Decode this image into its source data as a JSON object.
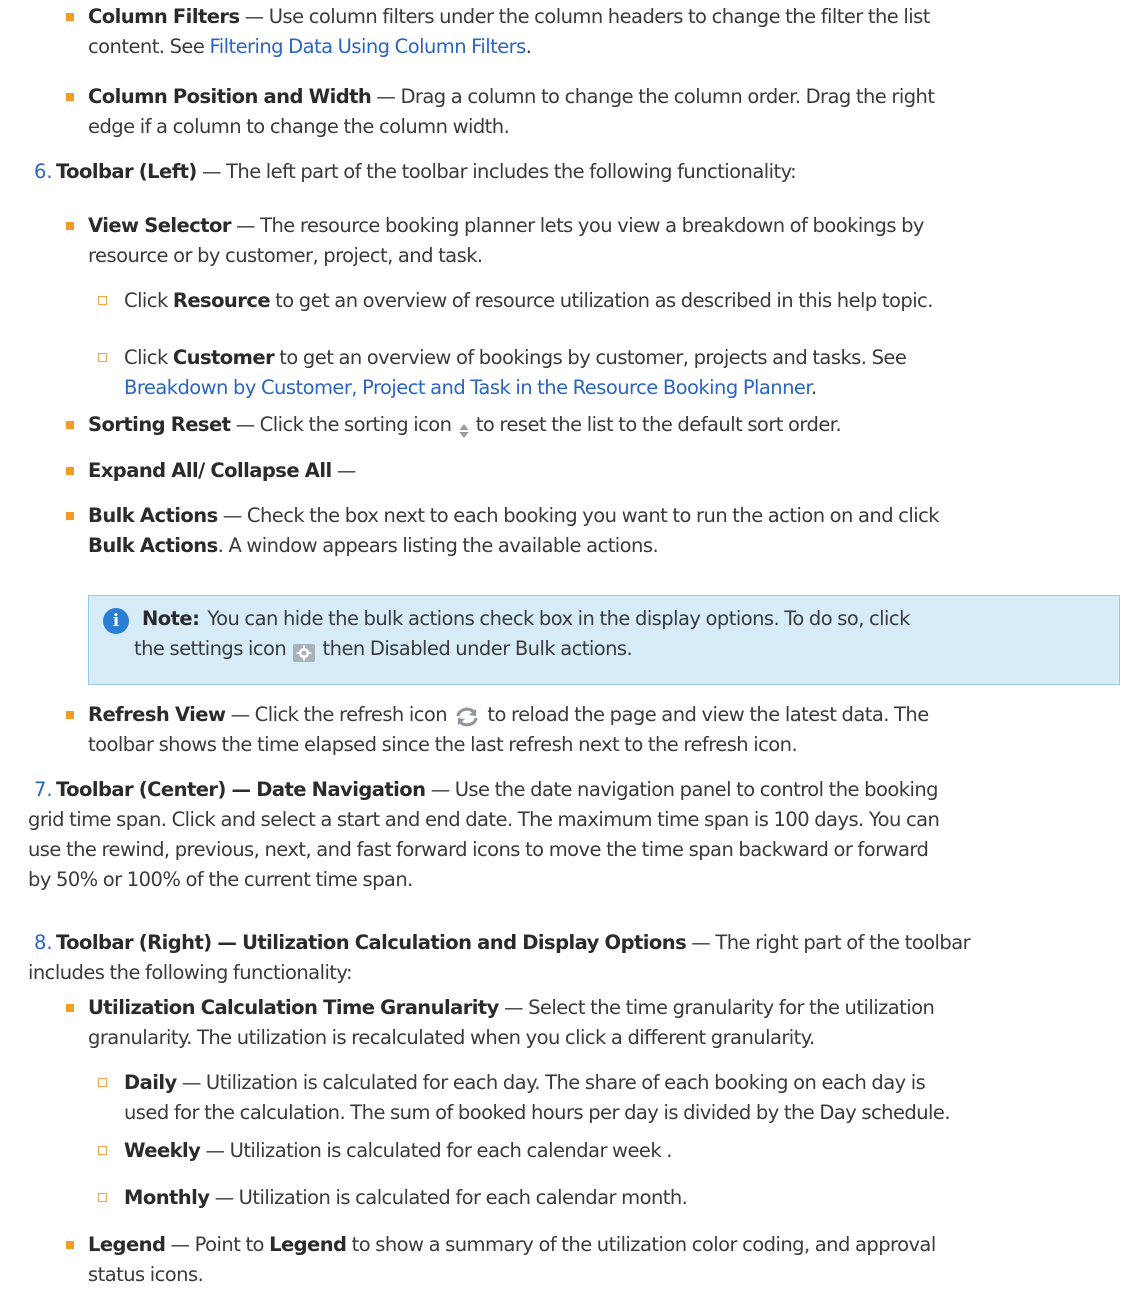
{
  "items": {
    "col_filters_title": "Column Filters",
    "col_filters_text_1": " — Use column filters under the column headers to change the filter the list",
    "col_filters_text_2": "content. See ",
    "col_filters_link": "Filtering Data Using Column Filters",
    "col_filters_end": ".",
    "col_pos_title": "Column Position and Width",
    "col_pos_text_1": " — Drag a column to change the column order. Drag the right",
    "col_pos_text_2": "edge if a column to change the column width.",
    "n6": "6.",
    "tb_left_title": "Toolbar (Left)",
    "tb_left_text": " — The left part of the toolbar includes the following functionality:",
    "view_sel_title": "View Selector",
    "view_sel_text_1": " — The resource booking planner lets you view a breakdown of bookings by",
    "view_sel_text_2": "resource or by customer, project, and task.",
    "resource_pre": "Click ",
    "resource_bold": "Resource",
    "resource_text": " to get an overview of resource utilization as described in this help topic.",
    "customer_pre": "Click ",
    "customer_bold": "Customer",
    "customer_text": " to get an overview of bookings by customer, projects and tasks. See",
    "customer_link": "Breakdown by Customer, Project and Task in the Resource Booking Planner",
    "customer_end": ".",
    "sort_title": "Sorting Reset",
    "sort_text_1": " — Click the sorting icon ",
    "sort_text_2": " to reset the list to the default sort order.",
    "expand_title": "Expand All/ Collapse All",
    "expand_text": " —",
    "bulk_title": "Bulk Actions",
    "bulk_text_1": " — Check the box next to each booking you want to run the action on and click",
    "bulk_bold_2": "Bulk Actions",
    "bulk_text_2": ". A window appears listing the available actions.",
    "note_label": "Note:",
    "note_text_1": "You can hide the bulk actions check box in the display options. To do so, click",
    "note_text_2a": "the settings icon ",
    "note_text_2b": " then Disabled under Bulk actions.",
    "refresh_title": "Refresh View",
    "refresh_text_1a": " — Click the refresh icon ",
    "refresh_text_1b": " to reload the page and view the latest data. The",
    "refresh_text_2": "toolbar shows the time elapsed since the last refresh next to the refresh icon.",
    "n7": "7.",
    "tb_center_title": "Toolbar (Center) — Date Navigation",
    "tb_center_text_1": " — Use the date navigation panel to control the booking",
    "tb_center_text_2": "grid time span. Click and select a start and end date. The maximum time span is 100 days. You can",
    "tb_center_text_3": "use the rewind, previous, next, and fast forward icons to move the time span backward or forward",
    "tb_center_text_4": "by 50% or 100% of the current time span.",
    "n8": "8.",
    "tb_right_title": "Toolbar (Right) — Utilization Calculation and Display Options",
    "tb_right_text_1": " — The right part of the toolbar",
    "tb_right_text_2": "includes the following functionality:",
    "util_title": "Utilization Calculation Time Granularity",
    "util_text_1": " — Select the time granularity for the utilization",
    "util_text_2": "granularity. The utilization is recalculated when you click a different granularity.",
    "daily_title": "Daily",
    "daily_text_1": " — Utilization is calculated for each day. The share of each booking on each day is",
    "daily_text_2": "used for the calculation. The sum of booked hours per day is divided by the Day schedule.",
    "weekly_title": "Weekly",
    "weekly_text": " — Utilization is calculated for each calendar week .",
    "monthly_title": "Monthly",
    "monthly_text": " — Utilization is calculated for each calendar month.",
    "legend_title": "Legend",
    "legend_pre": " — Point to ",
    "legend_bold": "Legend",
    "legend_text_1": " to show a summary of the utilization color coding, and approval",
    "legend_text_2": "status icons."
  },
  "icons": {
    "sort": "sort-icon",
    "settings": "gear-icon",
    "refresh": "refresh-icon",
    "info": "info-icon"
  },
  "colors": {
    "link": "#2a65c4",
    "bullet": "#f39c22",
    "note_bg": "#d7ecf9",
    "note_border": "#9ccbe9"
  }
}
